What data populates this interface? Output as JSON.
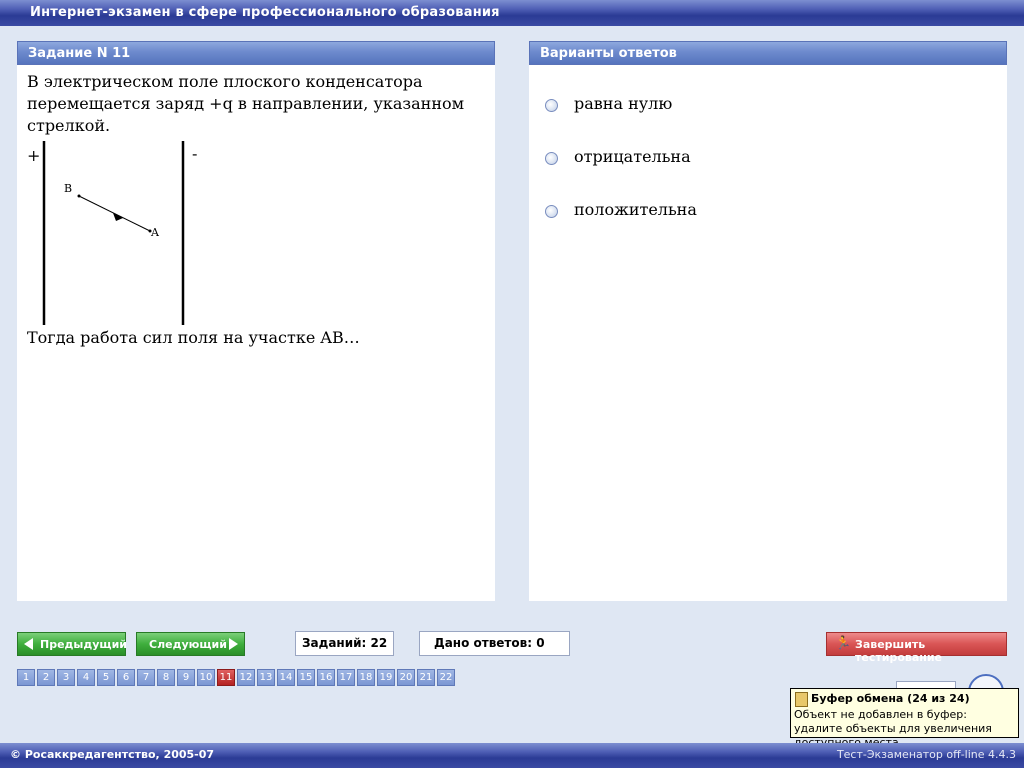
{
  "app": {
    "title": "Интернет-экзамен в сфере профессионального образования"
  },
  "task": {
    "header": "Задание N 11",
    "text1": "В электрическом поле плоского конденсатора перемещается заряд +q в направлении, указанном стрелкой.",
    "plus_sign": "+",
    "minus_sign": "-",
    "point_b": "B",
    "point_a": "A",
    "text2": "Тогда работа сил поля на участке AB…"
  },
  "answers": {
    "header": "Варианты ответов",
    "options": [
      {
        "label": "равна нулю"
      },
      {
        "label": "отрицательна"
      },
      {
        "label": "положительна"
      }
    ]
  },
  "controls": {
    "prev_label": "Предыдущий",
    "next_label": "Следующий",
    "tasks_count": "Заданий: 22",
    "answers_given": "Дано ответов: 0",
    "finish_label": "Завершить тестирование"
  },
  "pages": {
    "items": [
      "1",
      "2",
      "3",
      "4",
      "5",
      "6",
      "7",
      "8",
      "9",
      "10",
      "11",
      "12",
      "13",
      "14",
      "15",
      "16",
      "17",
      "18",
      "19",
      "20",
      "21",
      "22"
    ],
    "current": "11"
  },
  "tooltip": {
    "title": "Буфер обмена (24 из 24)",
    "body": "Объект не добавлен в буфер: удалите объекты для увеличения доступного места"
  },
  "footer": {
    "copyright": "© Росаккредагентство, 2005-07",
    "version": "Тест-Экзаменатор off-line 4.4.3"
  }
}
